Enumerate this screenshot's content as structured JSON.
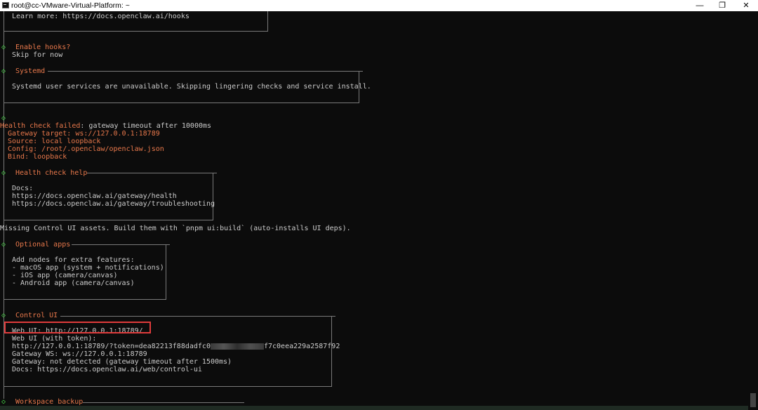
{
  "window": {
    "title": "root@cc-VMware-Virtual-Platform: ~",
    "minimize_glyph": "—",
    "maximize_glyph": "❐",
    "close_glyph": "✕",
    "titlebar_icon": "terminal-icon"
  },
  "colors": {
    "background": "#0c0c0c",
    "text": "#cccccc",
    "accent": "#e8784b",
    "bullet": "#44cc44",
    "highlight": "#e03c3c"
  },
  "terminal": {
    "hooks_learn_more": "Learn more: https://docs.openclaw.ai/hooks",
    "enable_hooks_q": "Enable hooks?",
    "skip_for_now": "Skip for now",
    "systemd_title": "Systemd",
    "systemd_msg": "Systemd user services are unavailable. Skipping lingering checks and service install.",
    "health_failed_label": "Health check failed",
    "health_failed_rest": ": gateway timeout after 10000ms",
    "gateway_target_label": "Gateway target: ",
    "gateway_target_value": "ws://127.0.0.1:18789",
    "source_line": "Source: local loopback",
    "config_label": "Config: ",
    "config_value": "/root/.openclaw/openclaw.json",
    "bind_label": "Bind: ",
    "bind_value": "loopback",
    "health_help_title": "Health check help",
    "health_help_docs": "Docs:",
    "health_help_link1": "https://docs.openclaw.ai/gateway/health",
    "health_help_link2": "https://docs.openclaw.ai/gateway/troubleshooting",
    "missing_assets": "Missing Control UI assets. Build them with `pnpm ui:build` (auto-installs UI deps).",
    "optional_apps_title": "Optional apps",
    "optional_intro": "Add nodes for extra features:",
    "optional_macos": "- macOS app (system + notifications)",
    "optional_ios": "- iOS app (camera/canvas)",
    "optional_android": "- Android app (camera/canvas)",
    "control_ui_title": "Control UI",
    "web_ui": "Web UI: http://127.0.0.1:18789/",
    "web_ui_token_label": "Web UI (with token):",
    "token_url_start": "http://127.0.0.1:18789/?token=dea82213f88dadfc0",
    "token_url_end": "f7c0eea229a2587f92",
    "gateway_ws": "Gateway WS: ws://127.0.0.1:18789",
    "gateway_status": "Gateway: not detected (gateway timeout after 1500ms)",
    "control_docs": "Docs: https://docs.openclaw.ai/web/control-ui",
    "workspace_backup_title": "Workspace backup",
    "bullet_glyph": "◇"
  }
}
